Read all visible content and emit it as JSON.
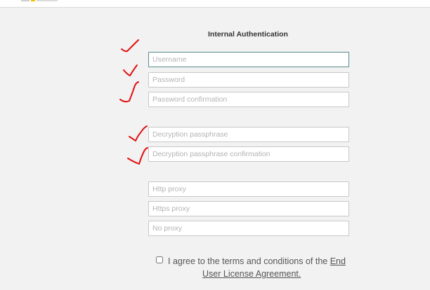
{
  "form": {
    "title": "Internal Authentication",
    "fields": {
      "username": {
        "placeholder": "Username",
        "value": ""
      },
      "password": {
        "placeholder": "Password",
        "value": ""
      },
      "password_confirmation": {
        "placeholder": "Password confirmation",
        "value": ""
      },
      "decryption_passphrase": {
        "placeholder": "Decryption passphrase",
        "value": ""
      },
      "decryption_passphrase_confirmation": {
        "placeholder": "Decryption passphrase confirmation",
        "value": ""
      },
      "http_proxy": {
        "placeholder": "Http proxy",
        "value": ""
      },
      "https_proxy": {
        "placeholder": "Https proxy",
        "value": ""
      },
      "no_proxy": {
        "placeholder": "No proxy",
        "value": ""
      }
    },
    "agreement": {
      "checked": false,
      "text_before": "I agree to the terms and conditions of the ",
      "link_part1": "End",
      "link_part2": "User License Agreement."
    }
  },
  "annotations": {
    "checkmark_color": "#e01010",
    "checkmark_count": 5
  },
  "colors": {
    "background": "#f2f2f2",
    "focused_border": "#5b8a8a",
    "field_border": "#c8c8c8"
  }
}
